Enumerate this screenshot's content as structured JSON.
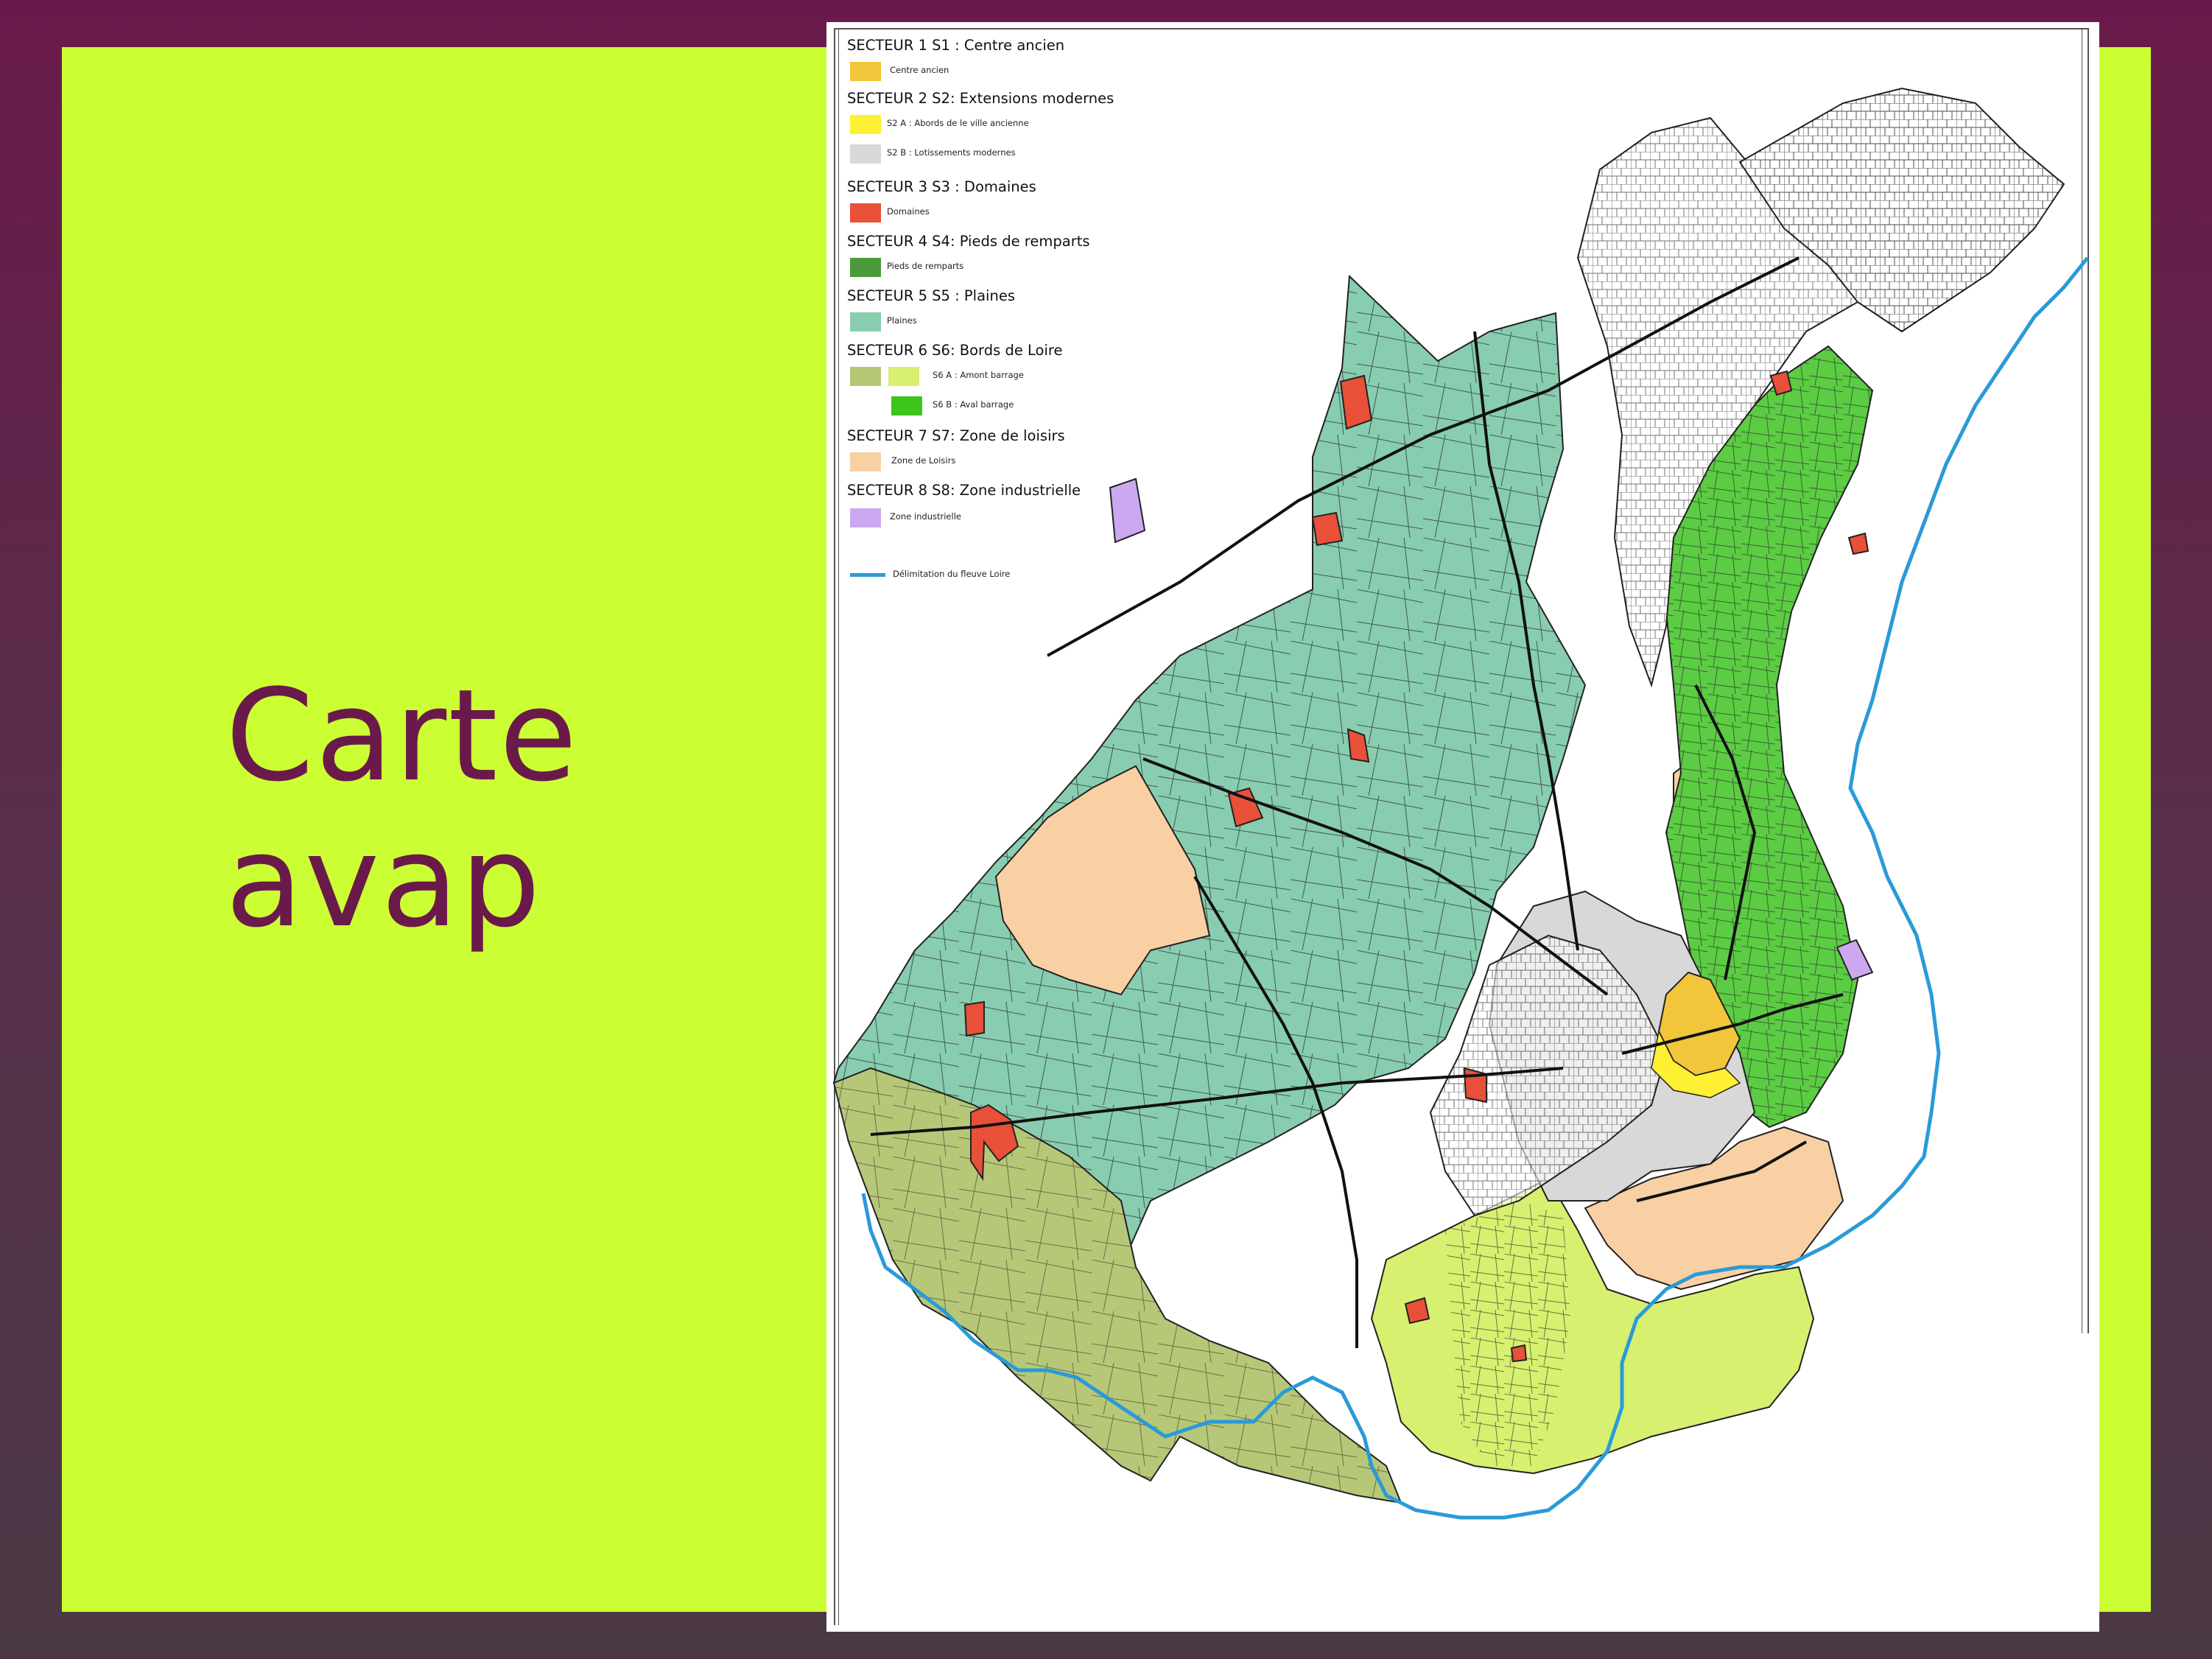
{
  "slide": {
    "title_line1": "Carte",
    "title_line2": "avap",
    "colors": {
      "background": "#6a1a4a",
      "panel": "#ccff33",
      "title": "#6a1a4a"
    }
  },
  "legend": {
    "s1": {
      "heading": "SECTEUR 1 S1 : Centre ancien",
      "item": "Centre ancien",
      "color": "#f2c63a"
    },
    "s2": {
      "heading": "SECTEUR 2 S2: Extensions modernes",
      "item_a": "S2 A : Abords de le ville ancienne",
      "color_a": "#fff033",
      "item_b": "S2 B : Lotissements modernes",
      "color_b": "#d8d8d8"
    },
    "s3": {
      "heading": "SECTEUR 3 S3 : Domaines",
      "item": "Domaines",
      "color": "#e8503a"
    },
    "s4": {
      "heading": "SECTEUR 4 S4: Pieds de remparts",
      "item": "Pieds de remparts",
      "color": "#4a9a3c"
    },
    "s5": {
      "heading": "SECTEUR 5 S5 : Plaines",
      "item": "Plaines",
      "color": "#88cdb0"
    },
    "s6": {
      "heading": "SECTEUR 6 S6: Bords de Loire",
      "item_a": "S6 A : Amont barrage",
      "color_a1": "#b6c878",
      "color_a2": "#d8f070",
      "item_b": "S6 B : Aval barrage",
      "color_b": "#3ec41c"
    },
    "s7": {
      "heading": "SECTEUR 7 S7: Zone de loisirs",
      "item": "Zone de Loisirs",
      "color": "#f8d0a4"
    },
    "s8": {
      "heading": "SECTEUR 8 S8: Zone industrielle",
      "item": "Zone industrielle",
      "color": "#cca8f0"
    },
    "river": {
      "label": "Délimitation du fleuve Loire",
      "color": "#2a9ad8"
    }
  },
  "map": {
    "zones": [
      {
        "name": "plaines",
        "sector": "S5",
        "color": "#88cdb0"
      },
      {
        "name": "bords-de-loire-amont",
        "sector": "S6 A",
        "color": "#b6c878"
      },
      {
        "name": "bords-de-loire-amont-light",
        "sector": "S6 A",
        "color": "#d8f070"
      },
      {
        "name": "aval-barrage",
        "sector": "S6 B",
        "color": "#5ccc44"
      },
      {
        "name": "zone-de-loisirs",
        "sector": "S7",
        "color": "#f8d0a4"
      },
      {
        "name": "lotissements-modernes",
        "sector": "S2 B",
        "color": "#d8d8d8"
      },
      {
        "name": "centre-ancien",
        "sector": "S1",
        "color": "#f2c63a"
      },
      {
        "name": "zone-industrielle",
        "sector": "S8",
        "color": "#cca8f0"
      },
      {
        "name": "domaines",
        "sector": "S3",
        "color": "#e8503a"
      }
    ],
    "river_color": "#2a9ad8",
    "road_color": "#111111"
  }
}
